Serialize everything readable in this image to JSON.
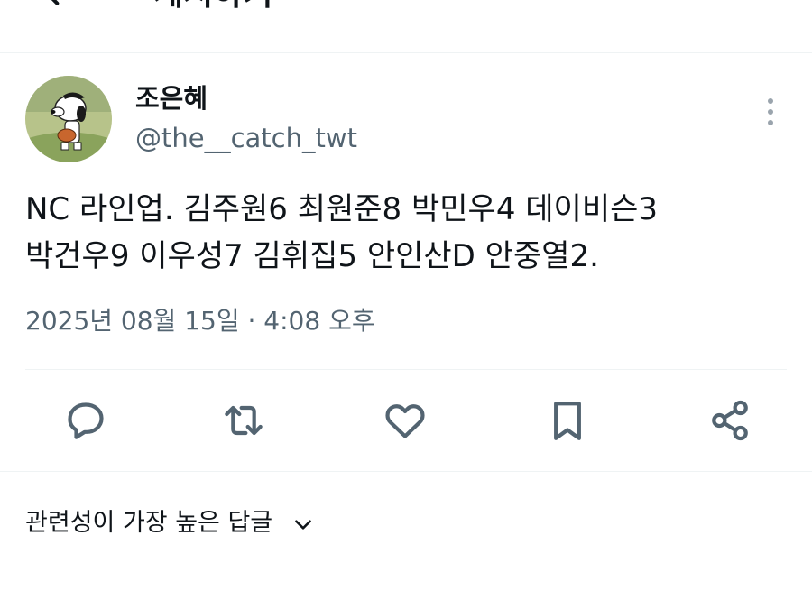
{
  "header": {
    "title": "게시하기",
    "back_icon": "arrow-left-icon"
  },
  "author": {
    "name": "조은혜",
    "handle": "@the__catch_twt",
    "avatar": "snoopy-baseball-avatar"
  },
  "tweet": {
    "text": "NC 라인업. 김주원6 최원준8 박민우4 데이비슨3\n박건우9 이우성7 김휘집5 안인산D 안중열2.",
    "timestamp": "2025년 08월 15일 · 4:08 오후"
  },
  "actions": {
    "reply_icon": "reply-icon",
    "retweet_icon": "retweet-icon",
    "like_icon": "heart-icon",
    "bookmark_icon": "bookmark-icon",
    "share_icon": "share-icon"
  },
  "replies_sort": {
    "label": "관련성이 가장 높은 답글"
  },
  "colors": {
    "text": "#0f1419",
    "secondary": "#536471",
    "border": "#eff3f4"
  }
}
